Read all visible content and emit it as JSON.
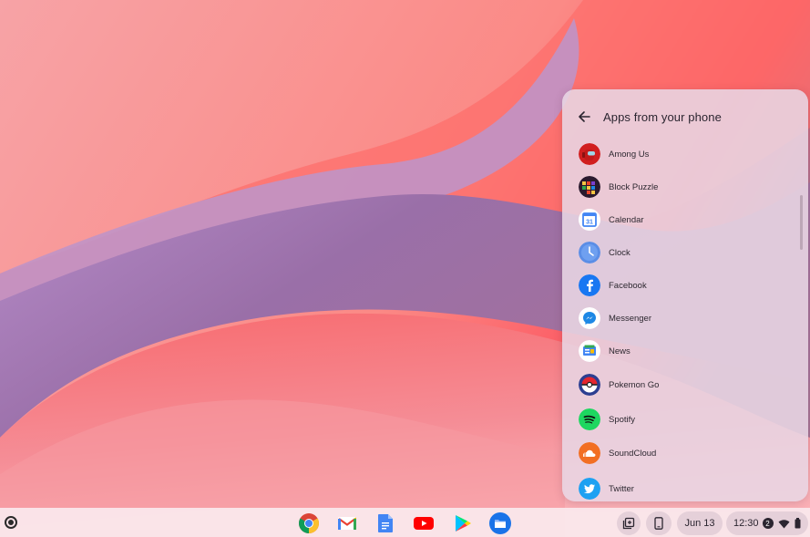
{
  "panel": {
    "title": "Apps from your phone",
    "apps": [
      {
        "label": "Among Us",
        "icon": "among-us-icon"
      },
      {
        "label": "Block Puzzle",
        "icon": "block-puzzle-icon"
      },
      {
        "label": "Calendar",
        "icon": "calendar-icon",
        "icon_text": "31"
      },
      {
        "label": "Clock",
        "icon": "clock-icon"
      },
      {
        "label": "Facebook",
        "icon": "facebook-icon",
        "icon_text": "f"
      },
      {
        "label": "Messenger",
        "icon": "messenger-icon"
      },
      {
        "label": "News",
        "icon": "news-icon"
      },
      {
        "label": "Pokemon Go",
        "icon": "pokeball-icon"
      },
      {
        "label": "Spotify",
        "icon": "spotify-icon"
      },
      {
        "label": "SoundCloud",
        "icon": "soundcloud-icon"
      },
      {
        "label": "Twitter",
        "icon": "twitter-icon"
      }
    ]
  },
  "shelf": {
    "apps": [
      "chrome-icon",
      "gmail-icon",
      "docs-icon",
      "youtube-icon",
      "play-store-icon",
      "files-icon"
    ],
    "date": "Jun 13",
    "time": "12:30",
    "notification_count": "2"
  },
  "colors": {
    "panel_bg": "#e8d6e4",
    "shelf_bg": "#fae8ec",
    "accent_blue": "#1a73e8"
  }
}
